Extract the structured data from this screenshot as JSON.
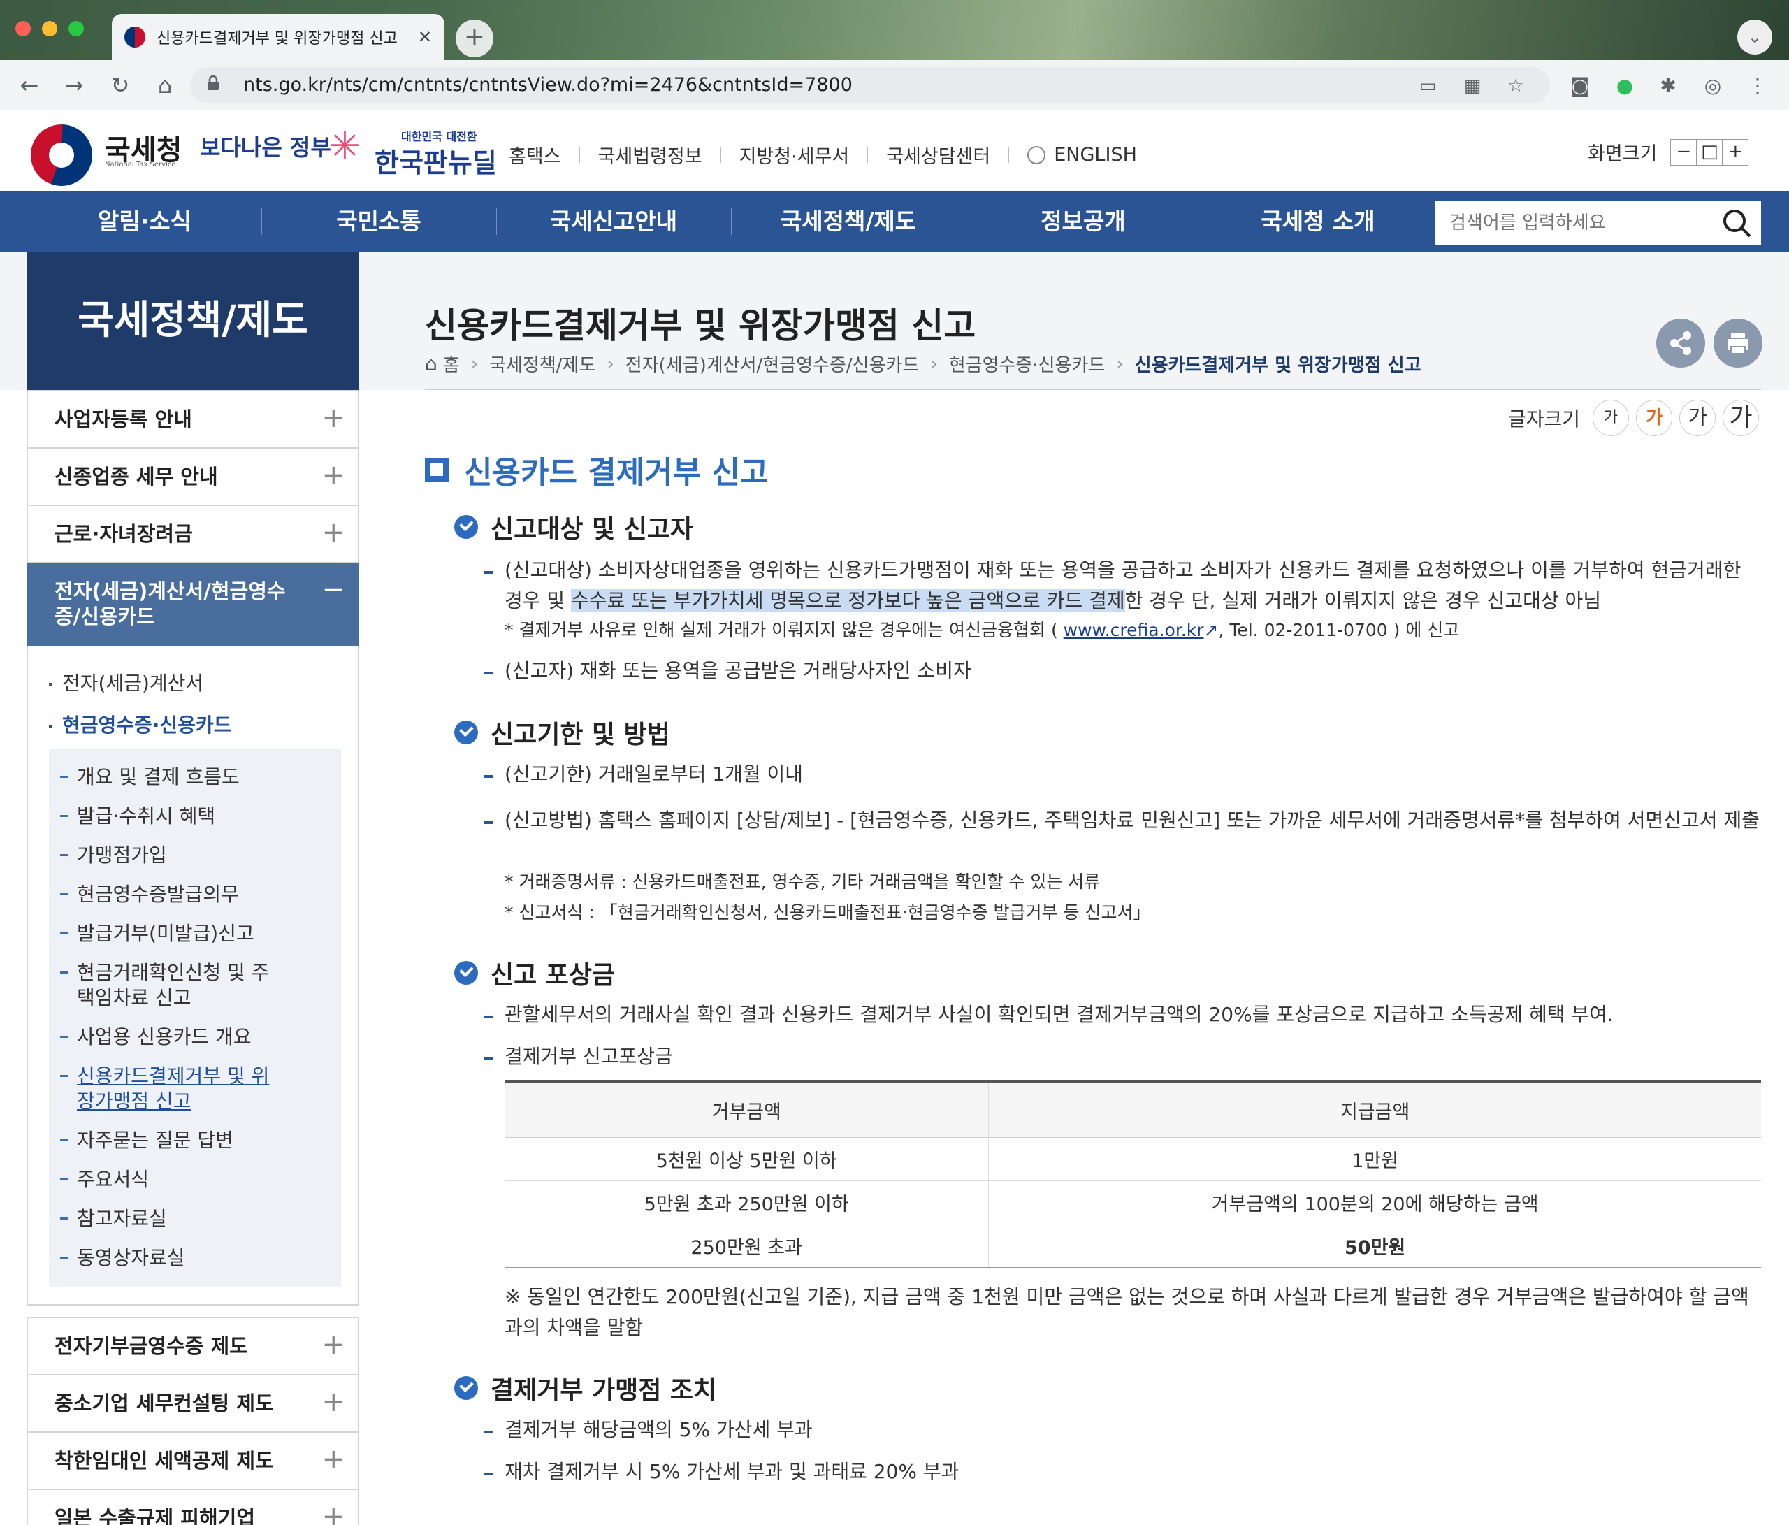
{
  "browser": {
    "tab_title": "신용카드결제거부 및 위장가맹점 신고",
    "new_tab_label": "+",
    "url": "nts.go.kr/nts/cm/cntnts/cntntsView.do?mi=2476&cntntsId=7800"
  },
  "header": {
    "logo_name": "국세청",
    "logo_sub": "National Tax Service",
    "gov_logo": "보다나은 정부",
    "newdeal_top": "대한민국 대전환",
    "newdeal_logo": "한국판뉴딜",
    "util_links": [
      "홈택스",
      "국세법령정보",
      "지방청·세무서",
      "국세상담센터",
      "ENGLISH"
    ],
    "zoom_label": "화면크기",
    "zoom_buttons": [
      "−",
      "□",
      "+"
    ]
  },
  "gnb": {
    "items": [
      "알림·소식",
      "국민소통",
      "국세신고안내",
      "국세정책/제도",
      "정보공개",
      "국세청 소개"
    ],
    "search_placeholder": "검색어를 입력하세요"
  },
  "lnb": {
    "title": "국세정책/제도",
    "items_top": [
      "사업자등록 안내",
      "신종업종 세무 안내",
      "근로·자녀장려금"
    ],
    "active_item": "전자(세금)계산서/현금영수증/신용카드",
    "sub_items": [
      "전자(세금)계산서",
      "현금영수증·신용카드"
    ],
    "sub3_items": [
      "개요 및 결제 흐름도",
      "발급·수취시 혜택",
      "가맹점가입",
      "현금영수증발급의무",
      "발급거부(미발급)신고",
      "현금거래확인신청 및 주택임차료 신고",
      "사업용 신용카드 개요",
      "신용카드결제거부 및 위장가맹점 신고",
      "자주묻는 질문 답변",
      "주요서식",
      "참고자료실",
      "동영상자료실"
    ],
    "items_bottom": [
      "전자기부금영수증 제도",
      "중소기업 세무컨설팅 제도",
      "착한임대인 세액공제 제도",
      "일본 수출규제 피해기업 세정지원"
    ],
    "plus": "+",
    "minus": "−"
  },
  "content": {
    "page_title": "신용카드결제거부 및 위장가맹점 신고",
    "breadcrumb": [
      "홈",
      "국세정책/제도",
      "전자(세금)계산서/현금영수증/신용카드",
      "현금영수증·신용카드",
      "신용카드결제거부 및 위장가맹점 신고"
    ],
    "font_size_label": "글자크기",
    "font_size_buttons": [
      "가",
      "가",
      "가",
      "가"
    ],
    "section_title": "신용카드 결제거부 신고",
    "s1": {
      "title": "신고대상 및 신고자",
      "p1_a": "(신고대상) 소비자상대업종을 영위하는 신용카드가맹점이 재화 또는 용역을 공급하고 소비자가 신용카드 결제를 요청하였으나 이를 거부하여 현금거래한 경우 및 ",
      "p1_hl": "수수료 또는 부가가치세 명목으로 정가보다 높은 금액으로 카드 결제",
      "p1_b": "한 경우 단, 실제 거래가 이뤄지지 않은 경우 신고대상 아님",
      "note_a": "* 결제거부 사유로 인해 실제 거래가 이뤄지지 않은 경우에는 여신금융협회 ( ",
      "note_link": "www.crefia.or.kr",
      "note_b": ", Tel. 02-2011-0700 ) 에 신고",
      "p2": "(신고자) 재화 또는 용역을 공급받은 거래당사자인 소비자"
    },
    "s2": {
      "title": "신고기한 및 방법",
      "p1": "(신고기한) 거래일로부터 1개월 이내",
      "p2": "(신고방법) 홈택스 홈페이지 [상담/제보] - [현금영수증, 신용카드, 주택임차료 민원신고] 또는 가까운 세무서에 거래증명서류*를 첨부하여 서면신고서 제출",
      "note1": "* 거래증명서류 : 신용카드매출전표, 영수증, 기타 거래금액을 확인할 수 있는 서류",
      "note2": "* 신고서식 : 「현금거래확인신청서, 신용카드매출전표·현금영수증 발급거부 등 신고서」"
    },
    "s3": {
      "title": "신고 포상금",
      "p1": "관할세무서의 거래사실 확인 결과 신용카드 결제거부 사실이 확인되면 결제거부금액의 20%를 포상금으로 지급하고 소득공제 혜택 부여.",
      "p2": "결제거부 신고포상금",
      "table_headers": [
        "거부금액",
        "지급금액"
      ],
      "table_rows": [
        [
          "5천원 이상 5만원 이하",
          "1만원"
        ],
        [
          "5만원 초과 250만원 이하",
          "거부금액의 100분의 20에 해당하는 금액"
        ],
        [
          "250만원 초과",
          "50만원"
        ]
      ],
      "table_note": "※ 동일인 연간한도 200만원(신고일 기준), 지급 금액 중 1천원 미만 금액은 없는 것으로 하며 사실과 다르게 발급한 경우 거부금액은 발급하여야 할 금액과의 차액을 말함"
    },
    "s4": {
      "title": "결제거부 가맹점 조치",
      "p1": "결제거부 해당금액의 5% 가산세 부과",
      "p2": "재차 결제거부 시 5% 가산세 부과 및 과태료 20% 부과"
    }
  }
}
